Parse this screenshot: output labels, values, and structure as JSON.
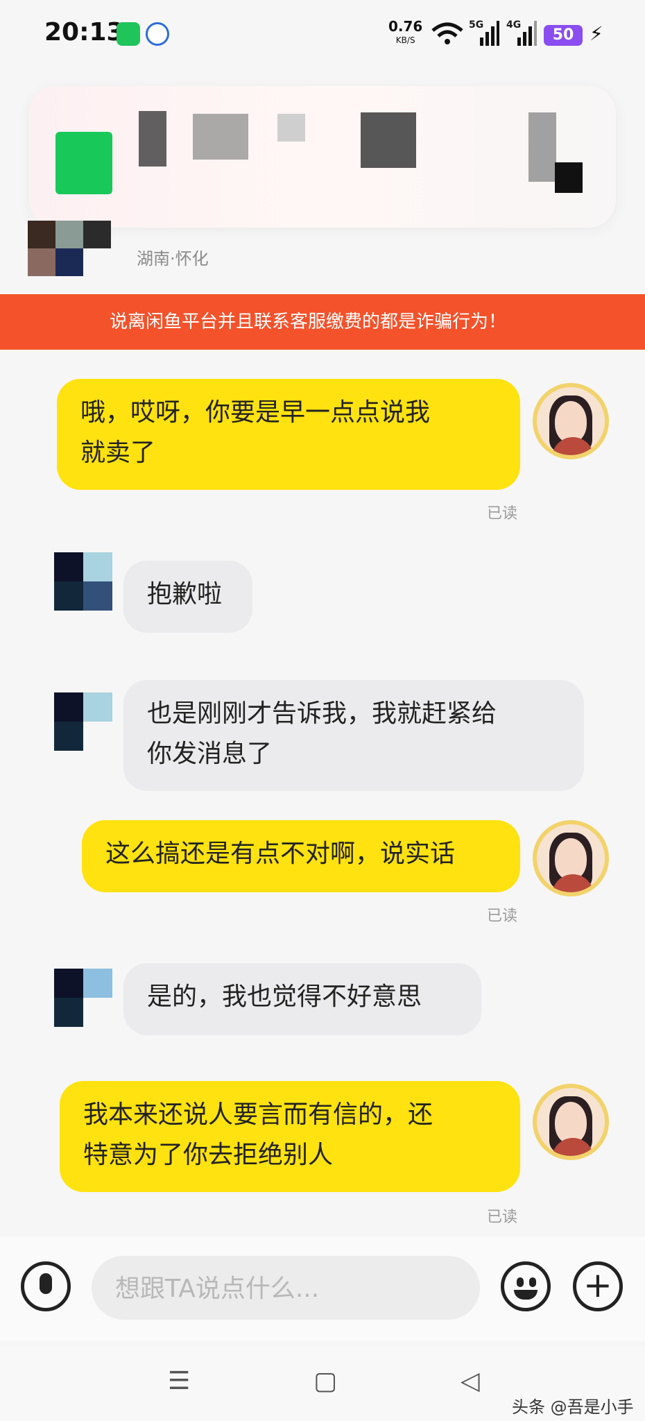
{
  "status_bar": {
    "time": "20:13",
    "net_speed": "0.76",
    "net_unit": "KB/S",
    "signal_1": "5G",
    "signal_2": "4G",
    "battery": "50"
  },
  "header": {
    "location": "湖南·怀化"
  },
  "warning": {
    "text": "说离闲鱼平台并且联系客服缴费的都是诈骗行为！"
  },
  "messages": [
    {
      "from": "me",
      "text_line1": "哦，哎呀，你要是早一点点说我",
      "text_line2": "就卖了",
      "status": "已读"
    },
    {
      "from": "them",
      "text_line1": "抱歉啦"
    },
    {
      "from": "them",
      "text_line1": "也是刚刚才告诉我，我就赶紧给",
      "text_line2": "你发消息了"
    },
    {
      "from": "me",
      "text_line1": "这么搞还是有点不对啊，说实话",
      "status": "已读"
    },
    {
      "from": "them",
      "text_line1": "是的，我也觉得不好意思"
    },
    {
      "from": "me",
      "text_line1": "我本来还说人要言而有信的，还",
      "text_line2": "特意为了你去拒绝别人",
      "status": "已读"
    }
  ],
  "input": {
    "placeholder": "想跟TA说点什么..."
  },
  "nav": {
    "menu_glyph": "☰",
    "home_glyph": "▢",
    "back_glyph": "◁"
  },
  "watermark": "头条 @吾是小手",
  "colors": {
    "my_bubble": "#ffe20f",
    "their_bubble": "#ebebed",
    "warning_bg": "#f4522b",
    "battery": "#8a4df0"
  }
}
